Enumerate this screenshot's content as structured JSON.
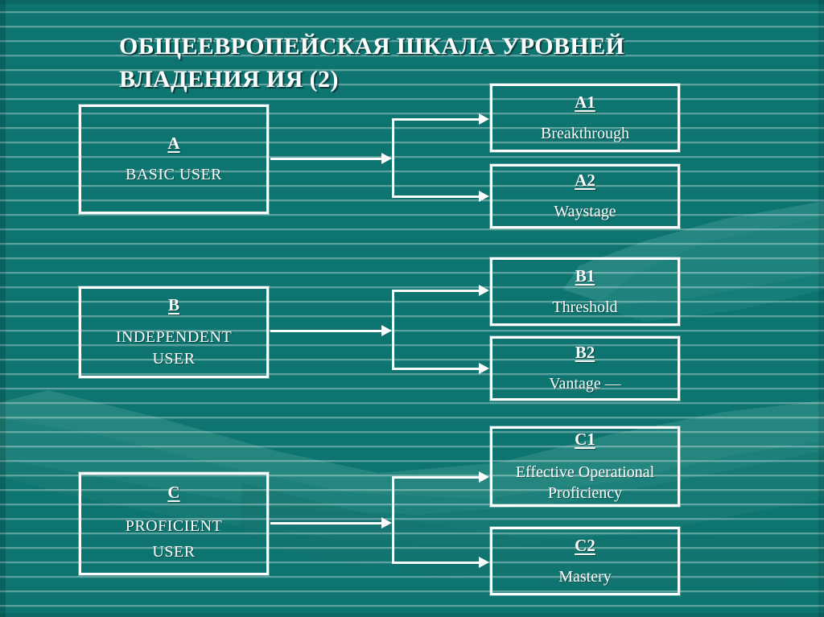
{
  "slide": {
    "title": "ОБЩЕЕВРОПЕЙСКАЯ ШКАЛА УРОВНЕЙ ВЛАДЕНИЯ ИЯ (2)",
    "background_color": "#0d7470",
    "accent_color": "#ffffff",
    "wave_color": "#2d8c86"
  },
  "levels": [
    {
      "code": "A",
      "name": "BASIC USER",
      "sublevels": [
        {
          "code": "A1",
          "name": "Breakthrough"
        },
        {
          "code": "A2",
          "name": "Waystage"
        }
      ]
    },
    {
      "code": "B",
      "name": "INDEPENDENT USER",
      "name_line1": "INDEPENDENT",
      "name_line2": "USER",
      "sublevels": [
        {
          "code": "B1",
          "name": "Threshold"
        },
        {
          "code": "B2",
          "name": "Vantage  —"
        }
      ]
    },
    {
      "code": "C",
      "name": "PROFICIENT USER",
      "name_line1": "PROFICIENT",
      "name_line2": "USER",
      "sublevels": [
        {
          "code": "C1",
          "name": "Effective Operational Proficiency"
        },
        {
          "code": "C2",
          "name": "Mastery"
        }
      ]
    }
  ]
}
